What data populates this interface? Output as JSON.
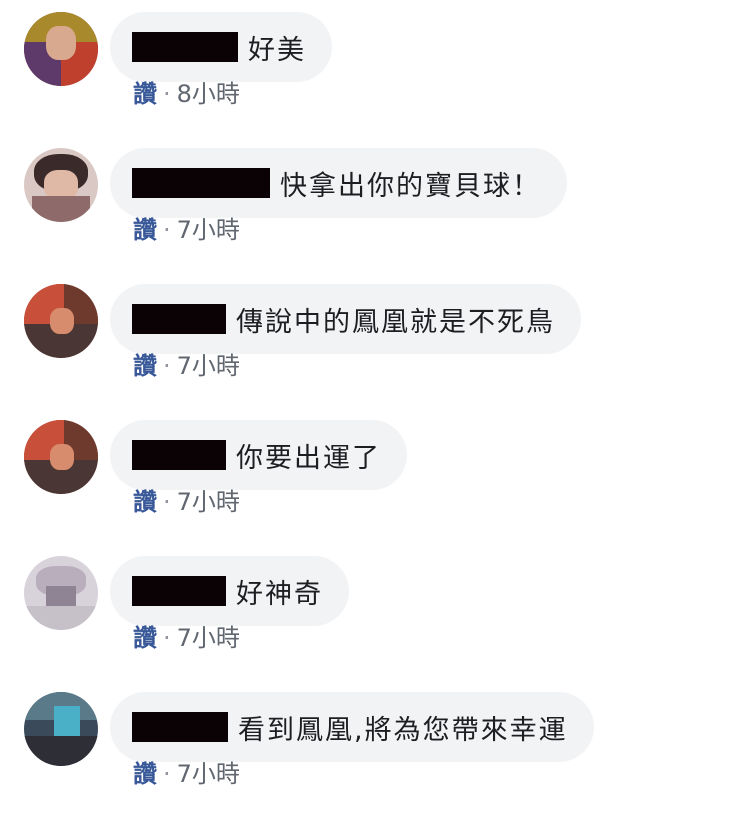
{
  "comments": [
    {
      "author_redacted": true,
      "text": "好美",
      "like_label": "讚",
      "separator": "·",
      "time": "8小時"
    },
    {
      "author_redacted": true,
      "text": "快拿出你的寶貝球！",
      "like_label": "讚",
      "separator": "·",
      "time": "7小時"
    },
    {
      "author_redacted": true,
      "text": "傳說中的鳳凰就是不死鳥",
      "like_label": "讚",
      "separator": "·",
      "time": "7小時"
    },
    {
      "author_redacted": true,
      "text": "你要出運了",
      "like_label": "讚",
      "separator": "·",
      "time": "7小時"
    },
    {
      "author_redacted": true,
      "text": "好神奇",
      "like_label": "讚",
      "separator": "·",
      "time": "7小時"
    },
    {
      "author_redacted": true,
      "text": "看到鳳凰,將為您帶來幸運",
      "like_label": "讚",
      "separator": "·",
      "time": "7小時"
    }
  ],
  "colors": {
    "bubble": "#f2f3f5",
    "like_link": "#385898",
    "meta_text": "#606770",
    "comment_text": "#1c1e21",
    "redaction": "#0a0204"
  }
}
